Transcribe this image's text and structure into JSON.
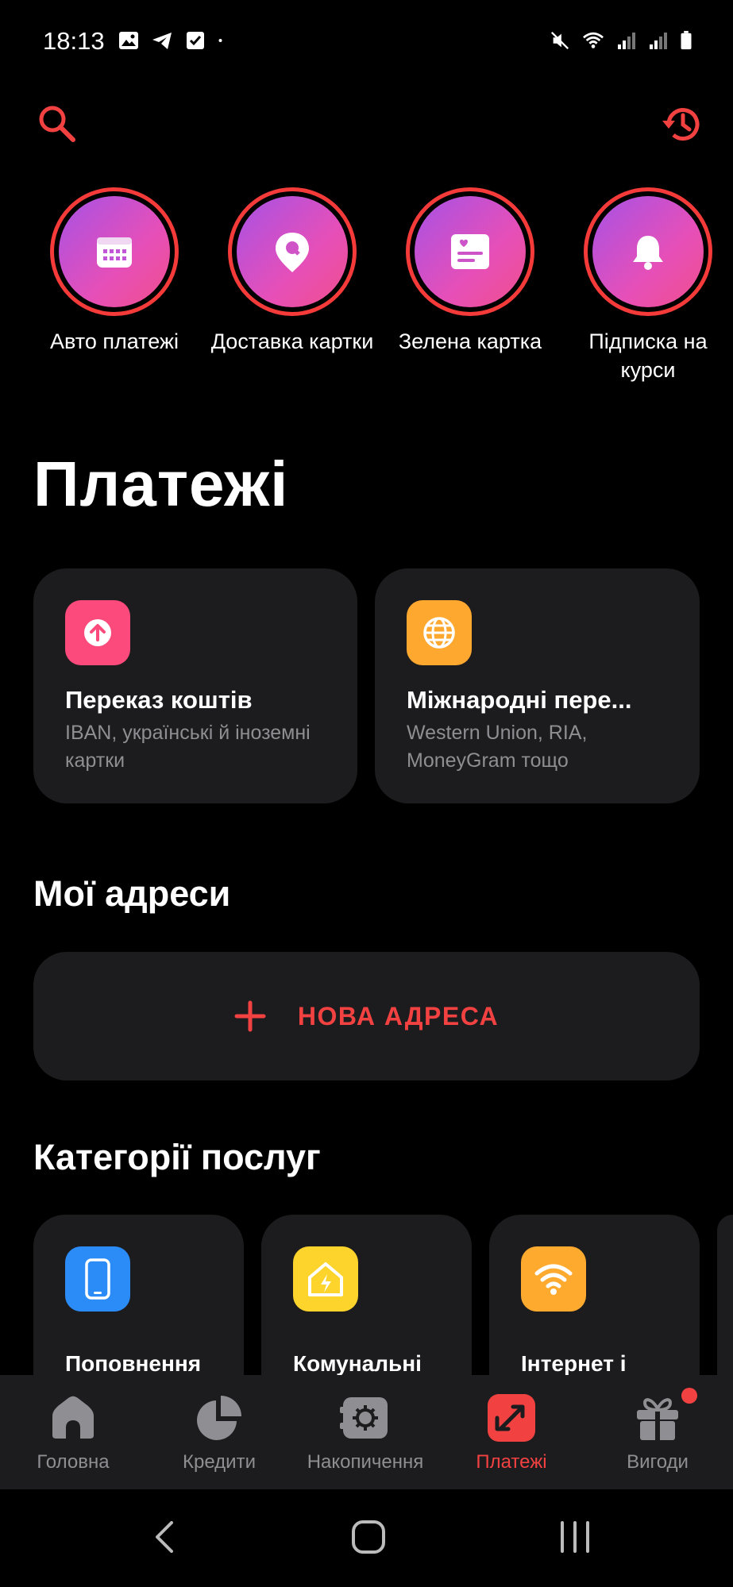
{
  "status_bar": {
    "time": "18:13",
    "left_icons": [
      "image-icon",
      "telegram-icon",
      "checkbox-icon",
      "dot-icon"
    ],
    "right_icons": [
      "mute-icon",
      "wifi-icon",
      "signal-icon",
      "signal-icon",
      "battery-icon"
    ]
  },
  "header": {
    "search_icon": "search-icon",
    "history_icon": "history-icon",
    "accent": "#f24141"
  },
  "stories": [
    {
      "label": "Авто платежі",
      "icon": "calendar-icon"
    },
    {
      "label": "Доставка картки",
      "icon": "location-pin-icon"
    },
    {
      "label": "Зелена картка",
      "icon": "document-card-icon"
    },
    {
      "label": "Підписка на курси",
      "icon": "bell-icon"
    }
  ],
  "page_title": "Платежі",
  "payment_cards": [
    {
      "title": "Переказ коштів",
      "subtitle": "IBAN, українські й іноземні картки",
      "icon": "arrow-up-icon",
      "color": "#fd4a7c"
    },
    {
      "title": "Міжнародні пере...",
      "subtitle": "Western Union, RIA, MoneyGram тощо",
      "icon": "globe-icon",
      "color": "#fea830"
    }
  ],
  "addresses": {
    "title": "Мої адреси",
    "new_address_label": "НОВА АДРЕСА",
    "plus_icon": "plus-icon"
  },
  "categories": {
    "title": "Категорії послуг",
    "items": [
      {
        "title": "Поповнення",
        "icon": "phone-icon",
        "color": "#2b8bf7"
      },
      {
        "title": "Комунальні",
        "icon": "house-icon",
        "color": "#fdd42b"
      },
      {
        "title": "Інтернет і",
        "icon": "wifi-icon",
        "color": "#feaa2f"
      }
    ]
  },
  "bottom_nav": [
    {
      "label": "Головна",
      "icon": "home-icon",
      "active": false
    },
    {
      "label": "Кредити",
      "icon": "pie-chart-icon",
      "active": false
    },
    {
      "label": "Накопичення",
      "icon": "safe-icon",
      "active": false
    },
    {
      "label": "Платежі",
      "icon": "payments-icon",
      "active": true
    },
    {
      "label": "Вигоди",
      "icon": "gift-icon",
      "active": false
    }
  ],
  "system_nav": [
    "back-icon",
    "home-button-icon",
    "recents-icon"
  ]
}
